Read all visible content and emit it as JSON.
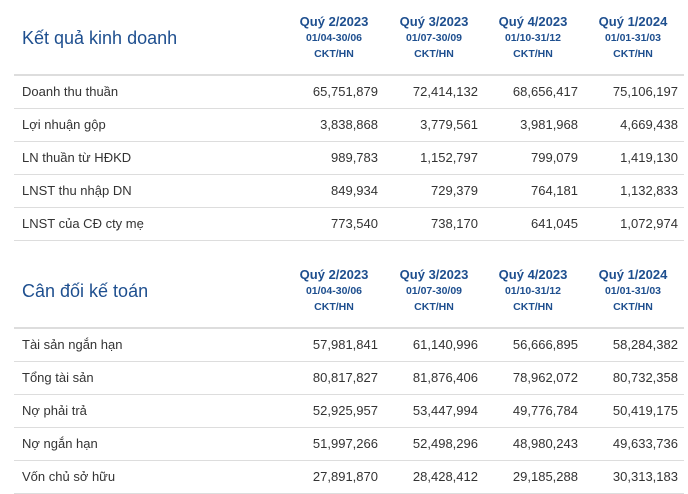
{
  "quarters": [
    {
      "label": "Quý 2/2023",
      "range": "01/04-30/06",
      "type": "CKT/HN"
    },
    {
      "label": "Quý 3/2023",
      "range": "01/07-30/09",
      "type": "CKT/HN"
    },
    {
      "label": "Quý 4/2023",
      "range": "01/10-31/12",
      "type": "CKT/HN"
    },
    {
      "label": "Quý 1/2024",
      "range": "01/01-31/03",
      "type": "CKT/HN"
    }
  ],
  "business": {
    "title": "Kết quả kinh doanh",
    "rows": [
      {
        "label": "Doanh thu thuần",
        "values": [
          "65,751,879",
          "72,414,132",
          "68,656,417",
          "75,106,197"
        ]
      },
      {
        "label": "Lợi nhuận gộp",
        "values": [
          "3,838,868",
          "3,779,561",
          "3,981,968",
          "4,669,438"
        ]
      },
      {
        "label": "LN thuần từ HĐKD",
        "values": [
          "989,783",
          "1,152,797",
          "799,079",
          "1,419,130"
        ]
      },
      {
        "label": "LNST thu nhập DN",
        "values": [
          "849,934",
          "729,379",
          "764,181",
          "1,132,833"
        ]
      },
      {
        "label": "LNST của CĐ cty mẹ",
        "values": [
          "773,540",
          "738,170",
          "641,045",
          "1,072,974"
        ]
      }
    ]
  },
  "balance": {
    "title": "Cân đối kế toán",
    "rows": [
      {
        "label": "Tài sản ngắn hạn",
        "values": [
          "57,981,841",
          "61,140,996",
          "56,666,895",
          "58,284,382"
        ]
      },
      {
        "label": "Tổng tài sản",
        "values": [
          "80,817,827",
          "81,876,406",
          "78,962,072",
          "80,732,358"
        ]
      },
      {
        "label": "Nợ phải trả",
        "values": [
          "52,925,957",
          "53,447,994",
          "49,776,784",
          "50,419,175"
        ]
      },
      {
        "label": "Nợ ngắn hạn",
        "values": [
          "51,997,266",
          "52,498,296",
          "48,980,243",
          "49,633,736"
        ]
      },
      {
        "label": "Vốn chủ sở hữu",
        "values": [
          "27,891,870",
          "28,428,412",
          "29,185,288",
          "30,313,183"
        ]
      }
    ]
  }
}
